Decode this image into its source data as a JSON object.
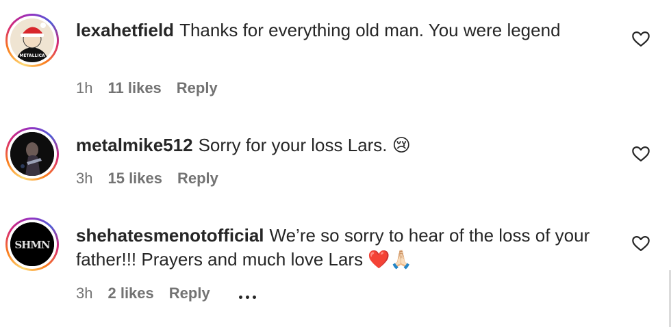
{
  "comments": [
    {
      "username": "lexahetfield",
      "text": "Thanks for everything old man. You were legend",
      "time": "1h",
      "likes": "11 likes",
      "reply": "Reply",
      "avatar_text": "METALLICA"
    },
    {
      "username": "metalmike512",
      "text": "Sorry for your loss Lars. 😢",
      "time": "3h",
      "likes": "15 likes",
      "reply": "Reply"
    },
    {
      "username": "shehatesmenotofficial",
      "text": "We’re so sorry to hear of the loss of your father!!! Prayers and much love Lars ❤️🙏🏻",
      "time": "3h",
      "likes": "2 likes",
      "reply": "Reply",
      "avatar_text": "SHMN"
    }
  ],
  "icons": {
    "like": "heart-outline-icon",
    "more": "more-options-icon"
  },
  "colors": {
    "text": "#262626",
    "meta": "#737373",
    "background": "#ffffff"
  }
}
